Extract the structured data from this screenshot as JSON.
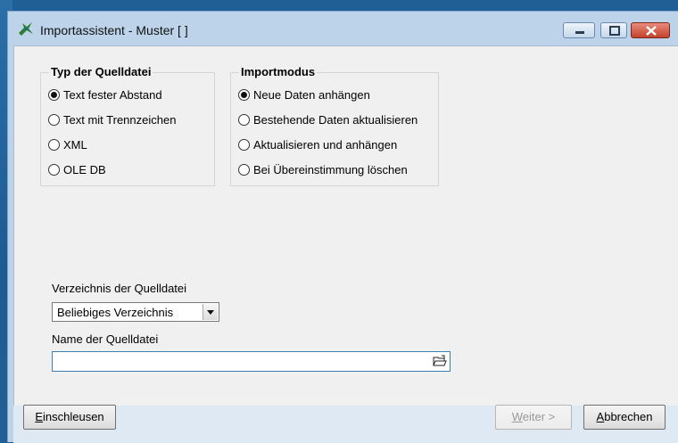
{
  "window": {
    "title": "Importassistent - Muster [ ]"
  },
  "source_type": {
    "title": "Typ der Quelldatei",
    "options": [
      {
        "label": "Text fester Abstand",
        "checked": true
      },
      {
        "label": "Text mit Trennzeichen",
        "checked": false
      },
      {
        "label": "XML",
        "checked": false
      },
      {
        "label": "OLE DB",
        "checked": false
      }
    ]
  },
  "import_mode": {
    "title": "Importmodus",
    "options": [
      {
        "label": "Neue Daten anhängen",
        "checked": true
      },
      {
        "label": "Bestehende Daten aktualisieren",
        "checked": false
      },
      {
        "label": "Aktualisieren und anhängen",
        "checked": false
      },
      {
        "label": "Bei Übereinstimmung löschen",
        "checked": false
      }
    ]
  },
  "source_dir": {
    "label": "Verzeichnis der Quelldatei",
    "value": "Beliebiges Verzeichnis"
  },
  "source_file": {
    "label": "Name der Quelldatei",
    "value": ""
  },
  "buttons": {
    "einschleusen_first": "E",
    "einschleusen_rest": "inschleusen",
    "weiter_first": "W",
    "weiter_rest": "eiter >",
    "abbrechen_first": "A",
    "abbrechen_rest": "bbrechen"
  },
  "icons": {
    "app": "app-icon",
    "minimize": "minimize-icon",
    "maximize": "maximize-icon",
    "close": "close-icon",
    "browse": "folder-open-icon"
  }
}
